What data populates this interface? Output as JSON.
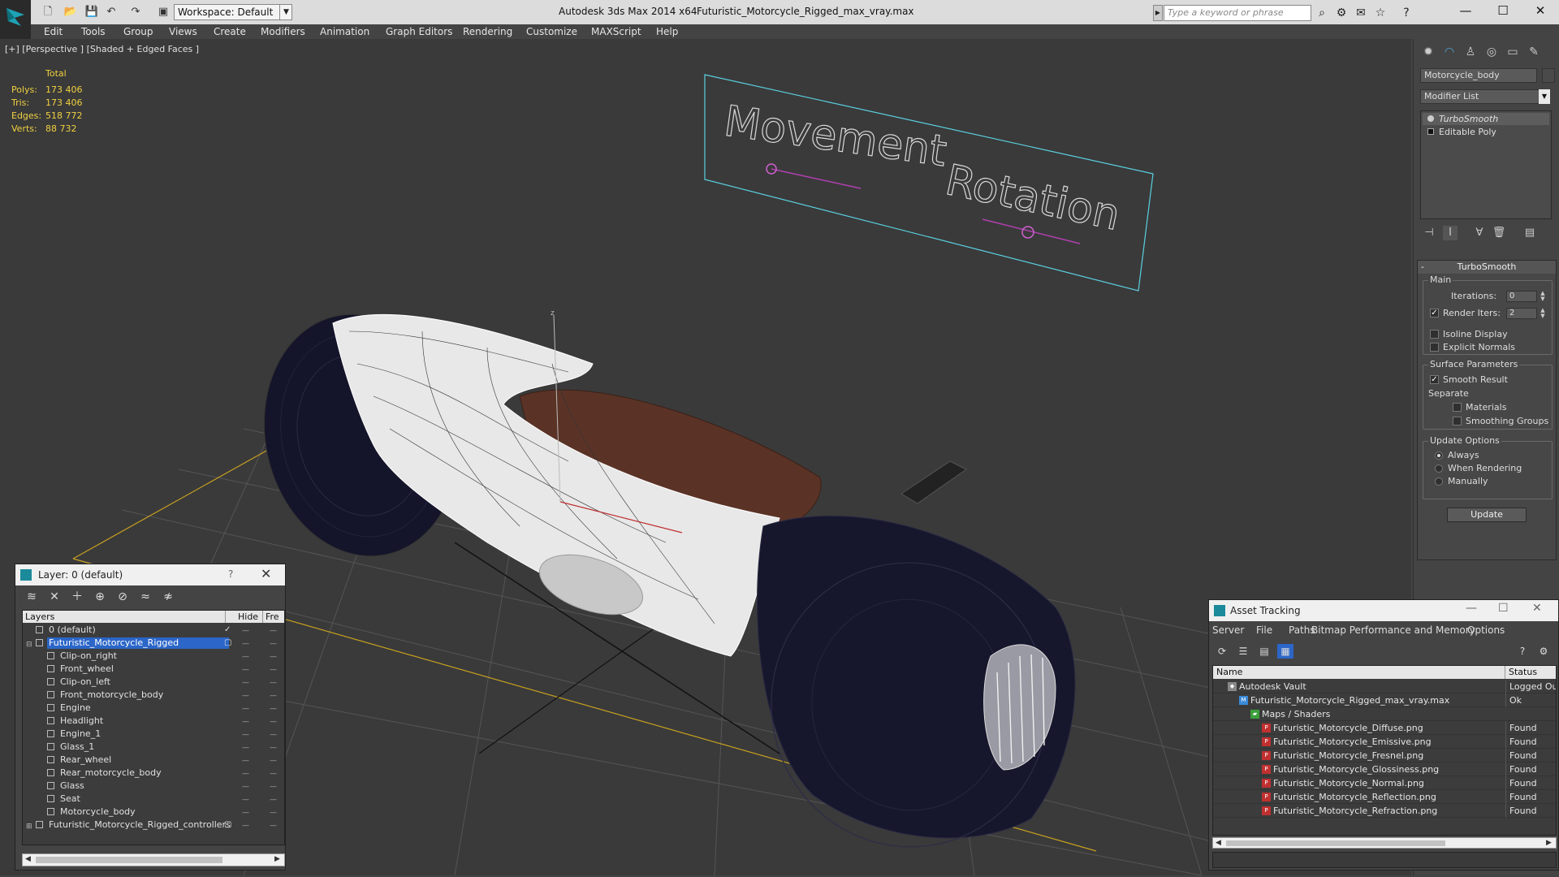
{
  "titlebar": {
    "workspace": "Workspace: Default",
    "app_title": "Autodesk 3ds Max  2014 x64",
    "doc_title": "Futuristic_Motorcycle_Rigged_max_vray.max",
    "search_placeholder": "Type a keyword or phrase"
  },
  "menu": [
    "Edit",
    "Tools",
    "Group",
    "Views",
    "Create",
    "Modifiers",
    "Animation",
    "Graph Editors",
    "Rendering",
    "Customize",
    "MAXScript",
    "Help"
  ],
  "viewport": {
    "label": "[+] [Perspective ] [Shaded + Edged Faces ]",
    "stats_header": "Total",
    "stats": [
      {
        "label": "Polys:",
        "value": "173 406"
      },
      {
        "label": "Tris:",
        "value": "173 406"
      },
      {
        "label": "Edges:",
        "value": "518 772"
      },
      {
        "label": "Verts:",
        "value": "88 732"
      }
    ],
    "rig_text_1": "Movement",
    "rig_text_2": "Rotation",
    "gizmo_z": "z",
    "colors": {
      "rig": "#5ad0e0",
      "slider": "#d060d0",
      "grid": "#555555",
      "grid_major": "#c8a020"
    }
  },
  "command_panel": {
    "object_name": "Motorcycle_body",
    "modifier_list": "Modifier List",
    "stack": [
      {
        "label": "TurboSmooth",
        "active": true
      },
      {
        "label": "Editable Poly",
        "active": false
      }
    ],
    "rollout": {
      "title": "TurboSmooth",
      "main_group": "Main",
      "iterations_label": "Iterations:",
      "iterations_value": "0",
      "render_iters_label": "Render Iters:",
      "render_iters_value": "2",
      "isoline": "Isoline Display",
      "explicit_normals": "Explicit Normals",
      "surface_group": "Surface Parameters",
      "smooth_result": "Smooth Result",
      "separate": "Separate",
      "materials": "Materials",
      "smoothing_groups": "Smoothing Groups",
      "update_group": "Update Options",
      "always": "Always",
      "when_rendering": "When Rendering",
      "manually": "Manually",
      "update_button": "Update"
    }
  },
  "layer_panel": {
    "title": "Layer: 0 (default)",
    "help": "?",
    "columns": [
      "Layers",
      "Hide",
      "Fre"
    ],
    "rows": [
      {
        "name": "0 (default)",
        "level": 0,
        "kind": "layer",
        "check": true
      },
      {
        "name": "Futuristic_Motorcycle_Rigged",
        "level": 0,
        "kind": "layer",
        "selected": true
      },
      {
        "name": "Clip-on_right",
        "level": 1,
        "kind": "object"
      },
      {
        "name": "Front_wheel",
        "level": 1,
        "kind": "object"
      },
      {
        "name": "Clip-on_left",
        "level": 1,
        "kind": "object"
      },
      {
        "name": "Front_motorcycle_body",
        "level": 1,
        "kind": "object"
      },
      {
        "name": "Engine",
        "level": 1,
        "kind": "object"
      },
      {
        "name": "Headlight",
        "level": 1,
        "kind": "object"
      },
      {
        "name": "Engine_1",
        "level": 1,
        "kind": "object"
      },
      {
        "name": "Glass_1",
        "level": 1,
        "kind": "object"
      },
      {
        "name": "Rear_wheel",
        "level": 1,
        "kind": "object"
      },
      {
        "name": "Rear_motorcycle_body",
        "level": 1,
        "kind": "object"
      },
      {
        "name": "Glass",
        "level": 1,
        "kind": "object"
      },
      {
        "name": "Seat",
        "level": 1,
        "kind": "object"
      },
      {
        "name": "Motorcycle_body",
        "level": 1,
        "kind": "object"
      },
      {
        "name": "Futuristic_Motorcycle_Rigged_controllers",
        "level": 0,
        "kind": "layer"
      }
    ]
  },
  "asset_panel": {
    "title": "Asset Tracking",
    "menu": [
      "Server",
      "File",
      "Paths",
      "Bitmap Performance and Memory",
      "Options"
    ],
    "columns": [
      "Name",
      "Status"
    ],
    "rows": [
      {
        "name": "Autodesk Vault",
        "status": "Logged Ou",
        "level": 0,
        "kind": "vault"
      },
      {
        "name": "Futuristic_Motorcycle_Rigged_max_vray.max",
        "status": "Ok",
        "level": 1,
        "kind": "max"
      },
      {
        "name": "Maps / Shaders",
        "status": "",
        "level": 2,
        "kind": "folder"
      },
      {
        "name": "Futuristic_Motorcycle_Diffuse.png",
        "status": "Found",
        "level": 3,
        "kind": "png"
      },
      {
        "name": "Futuristic_Motorcycle_Emissive.png",
        "status": "Found",
        "level": 3,
        "kind": "png"
      },
      {
        "name": "Futuristic_Motorcycle_Fresnel.png",
        "status": "Found",
        "level": 3,
        "kind": "png"
      },
      {
        "name": "Futuristic_Motorcycle_Glossiness.png",
        "status": "Found",
        "level": 3,
        "kind": "png"
      },
      {
        "name": "Futuristic_Motorcycle_Normal.png",
        "status": "Found",
        "level": 3,
        "kind": "png"
      },
      {
        "name": "Futuristic_Motorcycle_Reflection.png",
        "status": "Found",
        "level": 3,
        "kind": "png"
      },
      {
        "name": "Futuristic_Motorcycle_Refraction.png",
        "status": "Found",
        "level": 3,
        "kind": "png"
      }
    ]
  }
}
